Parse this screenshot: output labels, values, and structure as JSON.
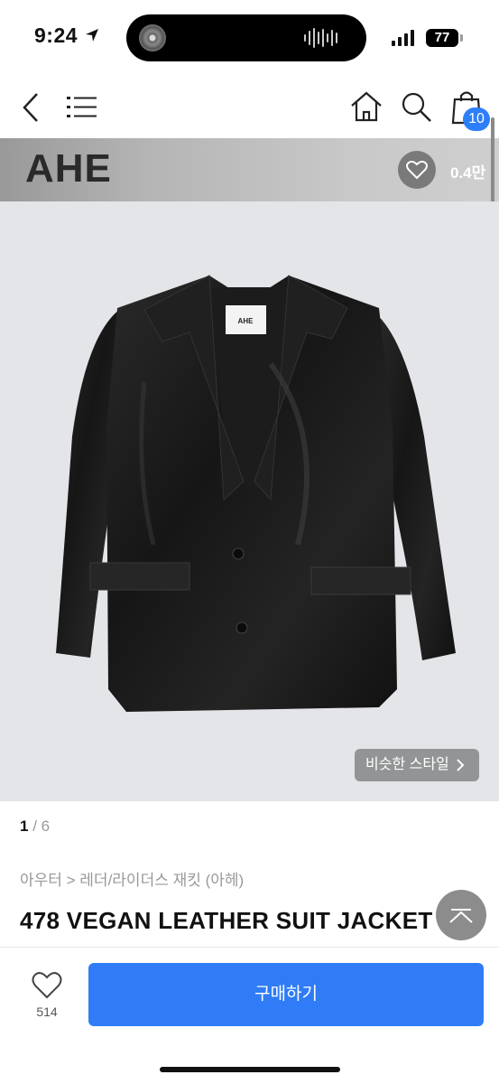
{
  "status_bar": {
    "time": "9:24",
    "battery": "77"
  },
  "header": {
    "cart_count": "10"
  },
  "brand": {
    "name": "AHE",
    "like_count": "0.4만"
  },
  "gallery": {
    "similar_style_label": "비슷한 스타일",
    "current_page": "1",
    "total_pages": "6",
    "tag_label": "AHE"
  },
  "product": {
    "category": "아우터 > 레더/라이더스 재킷 (아헤)",
    "title": "478 VEGAN LEATHER SUIT JACKET"
  },
  "bottom_bar": {
    "wish_count": "514",
    "buy_label": "구매하기"
  },
  "colors": {
    "accent": "#2f7cf6",
    "badge": "#2d7ff9"
  }
}
